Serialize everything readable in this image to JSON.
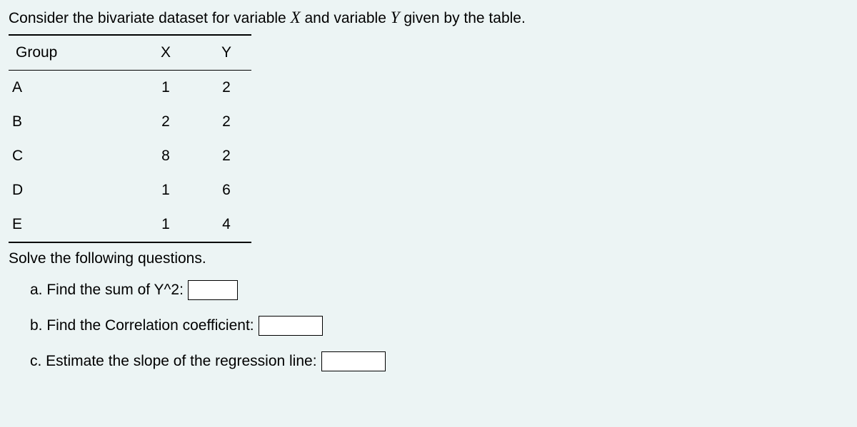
{
  "intro": {
    "prefix": "Consider the bivariate dataset for variable ",
    "var1": "X",
    "middle": " and variable ",
    "var2": "Y",
    "suffix": " given by the table."
  },
  "table": {
    "headers": {
      "group": "Group",
      "x": "X",
      "y": "Y"
    },
    "rows": [
      {
        "group": "A",
        "x": "1",
        "y": "2"
      },
      {
        "group": "B",
        "x": "2",
        "y": "2"
      },
      {
        "group": "C",
        "x": "8",
        "y": "2"
      },
      {
        "group": "D",
        "x": "1",
        "y": "6"
      },
      {
        "group": "E",
        "x": "1",
        "y": "4"
      }
    ]
  },
  "instruction": "Solve the following questions.",
  "questions": {
    "a": "a. Find the sum of Y^2:",
    "b": "b. Find the Correlation coefficient:",
    "c": "c. Estimate the slope of the regression line:"
  }
}
